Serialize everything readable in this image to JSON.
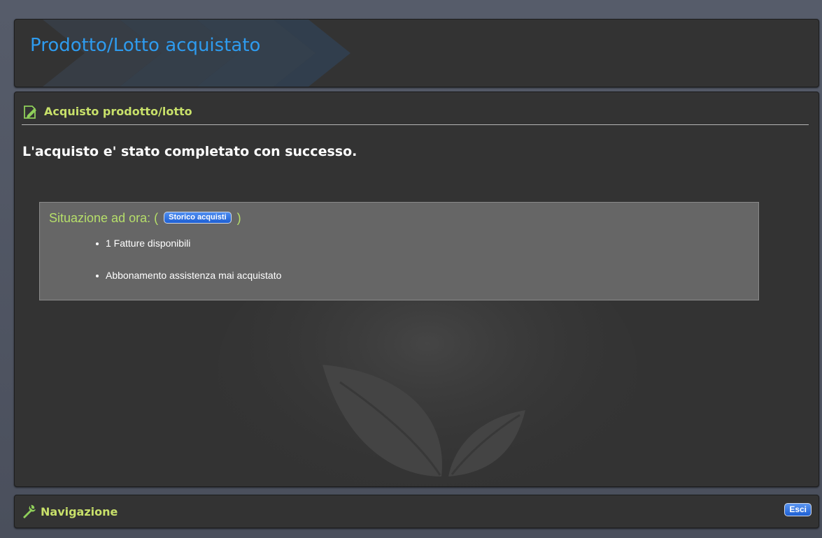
{
  "header": {
    "title": "Prodotto/Lotto acquistato"
  },
  "section": {
    "title": "Acquisto prodotto/lotto",
    "icon": "edit-document-icon"
  },
  "message": {
    "success": "L'acquisto e' stato completato con successo."
  },
  "status": {
    "heading_prefix": "Situazione ad ora: (",
    "heading_suffix": ")",
    "history_button_label": "Storico acquisti",
    "items": [
      "1 Fatture disponibili",
      "Abbonamento assistenza mai acquistato"
    ]
  },
  "footer": {
    "title": "Navigazione",
    "icon": "wrench-icon",
    "exit_label": "Esci"
  },
  "colors": {
    "title_blue": "#2e9bee",
    "accent_green": "#c8e06a",
    "panel_bg": "#333333",
    "status_box_bg": "#666666",
    "button_blue": "#1d5fd4"
  }
}
